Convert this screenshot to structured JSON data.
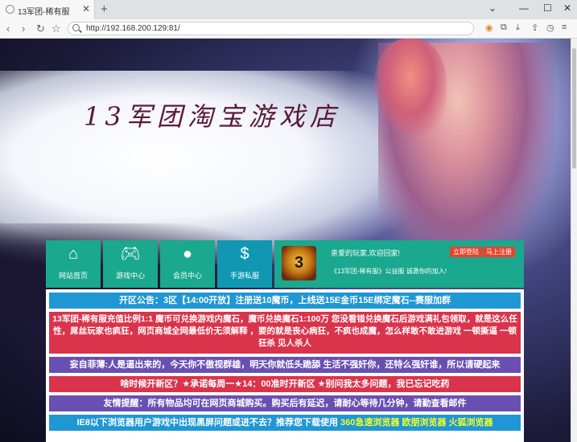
{
  "browser": {
    "tab_title": "13军团-稀有服",
    "new_tab": "+",
    "url": "http://192.168.200.129:81/"
  },
  "header": {
    "shop_title": "13军团淘宝游戏店"
  },
  "nav": {
    "tiles": [
      {
        "label": "网站首页",
        "icon": "home-icon"
      },
      {
        "label": "游戏中心",
        "icon": "gamepad-icon"
      },
      {
        "label": "会员中心",
        "icon": "user-icon"
      },
      {
        "label": "手游私服",
        "icon": "dollar-icon"
      }
    ]
  },
  "login": {
    "welcome": "亲爱的玩家,欢迎回家!",
    "login_button": "立即登陆",
    "register_button": "马上注册",
    "notice": "《13军团-稀有服》公益服 诚邀你的加入!",
    "badge": "3"
  },
  "announcements": {
    "a1": "开区公告：3区【14:00开放】注册送10魔币，上线送15E金币15E绑定魔石--赛服加群",
    "a2": "13军团-稀有服充值比例1:1 魔币可兑换游戏内魔石，魔币兑换魔石1:100万 您没看错兑换魔石后游戏满礼包领取，就是这么任性，屌丝玩家也疯狂，网页商城全网最低价无须解释 ，要的就是丧心病狂，不疯也成魔，怎么样敢不敢进游戏 一顿撕逼 一顿狂杀 见人杀人",
    "a3": "妄自菲薄:人是逼出来的，今天你不傲视群雄，明天你就低头跪舔 生活不强奸你，还特么强奸谁，所以请硬起来",
    "a4": "啥时候开新区？★承诺每周一★14：00准时开新区 ★别问我太多问题，我已忘记吃药",
    "a5": "友情提醒：所有物品均可在网页商城购买。购买后有延迟，请耐心等待几分钟，请勤查看邮件",
    "a6_prefix": "IE8以下浏览器用户游戏中出现黑屏问题或进不去？推荐您下载使用",
    "a6_links": [
      "360急速浏览器",
      "欧朋浏览器",
      "火狐浏览器"
    ]
  },
  "colors": {
    "tile_green": "#1aa88e",
    "tile_blue": "#1098b2",
    "bar_blue": "#1f97d4",
    "bar_red": "#d9344b",
    "bar_purple": "#6a4fb3",
    "highlight_yellow": "#f5ff2a",
    "button_red": "#e8432d"
  }
}
